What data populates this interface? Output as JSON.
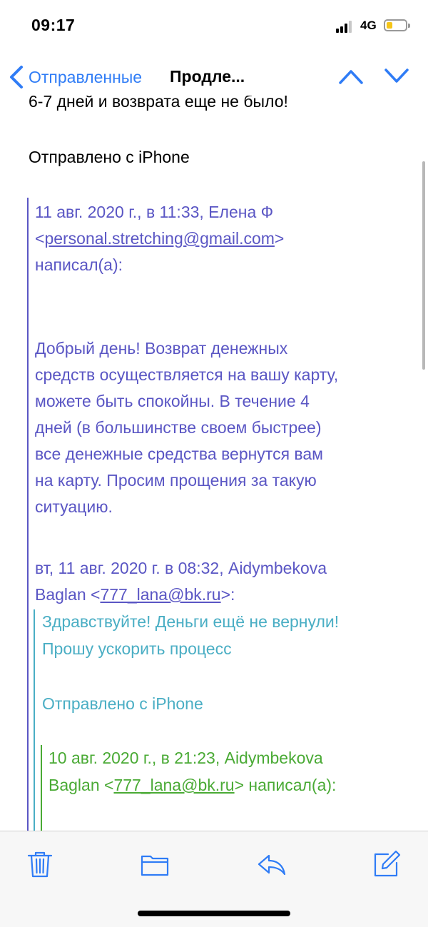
{
  "status_bar": {
    "time": "09:17",
    "network": "4G"
  },
  "nav": {
    "back_label": "Отправленные",
    "title": "Продле..."
  },
  "email": {
    "top_cut_line": "6-7 дней и возврата еще не было!",
    "signature": "Отправлено с iPhone",
    "quote1": {
      "header_line1": "11 авг. 2020 г., в 11:33, Елена Ф",
      "email_prefix": "<",
      "email": "personal.stretching@gmail.com",
      "email_suffix": ">",
      "wrote": "написал(а):",
      "body": [
        "Добрый день! Возврат денежных",
        "средств осуществляется на вашу карту,",
        "можете быть спокойны. В течение 4",
        "дней (в большинстве своем быстрее)",
        "все денежные средства вернутся вам",
        "на карту. Просим прощения за такую",
        "ситуацию."
      ],
      "reply_header_line1": "вт, 11 авг. 2020 г. в 08:32, Aidymbekova",
      "reply_header_prefix": "Baglan <",
      "reply_header_email": "777_lana@bk.ru",
      "reply_header_suffix": ">:"
    },
    "quote2": {
      "body": [
        "Здравствуйте! Деньги ещё не вернули!",
        "Прошу ускорить процесс"
      ],
      "signature": "Отправлено с iPhone"
    },
    "quote3": {
      "header_line1": "10 авг. 2020 г., в 21:23, Aidymbekova",
      "header_prefix": "Baglan <",
      "header_email": "777_lana@bk.ru",
      "header_suffix": "> написал(а):"
    }
  },
  "colors": {
    "accent": "#2f7cf6",
    "quote_level1": "#5a56c4",
    "quote_level2": "#4aaec4",
    "quote_level3": "#4aaa35"
  },
  "toolbar": {
    "icons": [
      "trash-icon",
      "folder-icon",
      "reply-icon",
      "compose-icon"
    ]
  }
}
